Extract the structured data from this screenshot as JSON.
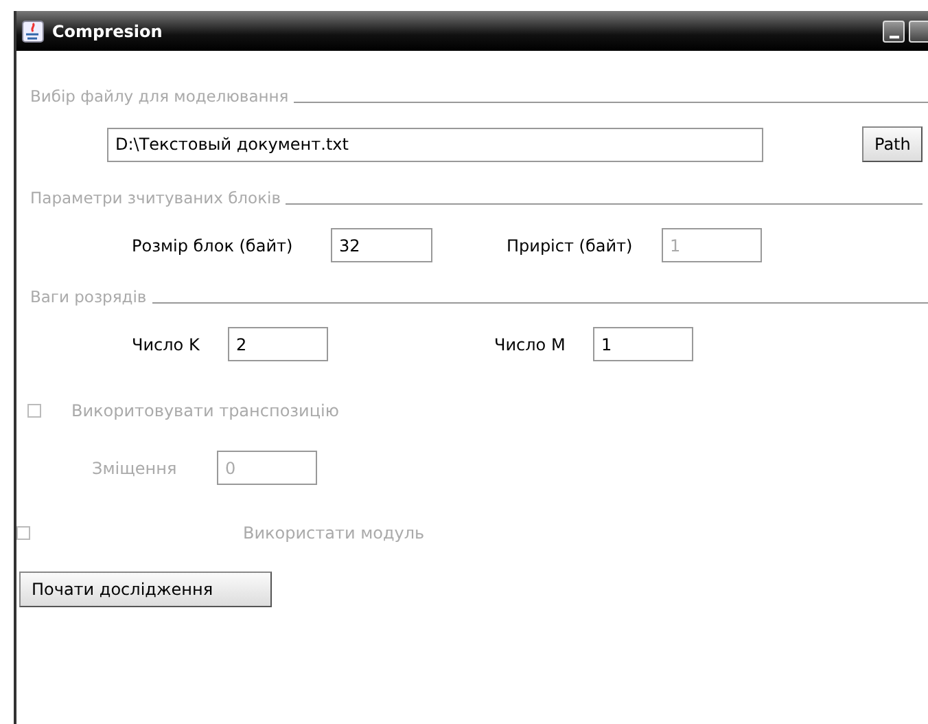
{
  "window": {
    "title": "Compresion"
  },
  "file_section": {
    "title": "Вибір файлу для моделювання",
    "path": "D:\\Текстовый документ.txt",
    "button": "Path"
  },
  "blocks_section": {
    "title": "Параметри зчитуваних блоків",
    "fields": [
      {
        "label": "Розмір блок (байт)",
        "value": "32",
        "disabled": false
      },
      {
        "label": "Приріст (байт)",
        "value": "1",
        "disabled": true
      }
    ]
  },
  "weights_section": {
    "title": "Ваги розрядів",
    "fields": [
      {
        "label": "Число K",
        "value": "2",
        "disabled": false
      },
      {
        "label": "Число M",
        "value": "1",
        "disabled": false
      }
    ]
  },
  "transposition": {
    "label": "Викоритовувати транспозицію",
    "checked": false,
    "disabled": true,
    "offset": {
      "label": "Зміщення",
      "value": "0",
      "disabled": true
    }
  },
  "modulus": {
    "label": "Використати модуль",
    "checked": false,
    "disabled": true
  },
  "start_button": "Почати дослідження"
}
